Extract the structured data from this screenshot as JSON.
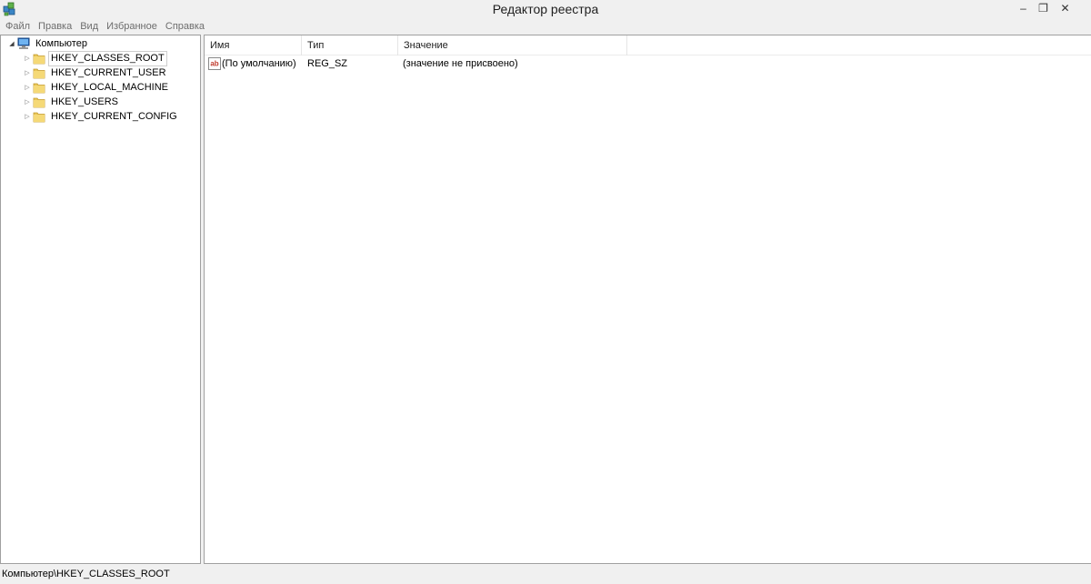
{
  "window": {
    "title": "Редактор реестра",
    "icon": "registry-editor-icon",
    "controls": {
      "minimize": "–",
      "restore": "❐",
      "close": "✕"
    }
  },
  "menu": {
    "items": [
      "Файл",
      "Правка",
      "Вид",
      "Избранное",
      "Справка"
    ]
  },
  "tree": {
    "root": {
      "label": "Компьютер",
      "icon": "computer-icon",
      "expanded": true
    },
    "keys": [
      {
        "label": "HKEY_CLASSES_ROOT",
        "selected": true
      },
      {
        "label": "HKEY_CURRENT_USER",
        "selected": false
      },
      {
        "label": "HKEY_LOCAL_MACHINE",
        "selected": false
      },
      {
        "label": "HKEY_USERS",
        "selected": false
      },
      {
        "label": "HKEY_CURRENT_CONFIG",
        "selected": false
      }
    ]
  },
  "list": {
    "columns": {
      "name": "Имя",
      "type": "Тип",
      "value": "Значение"
    },
    "rows": [
      {
        "name": "(По умолчанию)",
        "type": "REG_SZ",
        "value": "(значение не присвоено)",
        "icon": "string-value-ab-icon"
      }
    ]
  },
  "status": {
    "path": "Компьютер\\HKEY_CLASSES_ROOT"
  },
  "colors": {
    "folder": "#e8c65a",
    "ab_icon_red": "#c0392b",
    "chrome": "#f0f0f0"
  }
}
